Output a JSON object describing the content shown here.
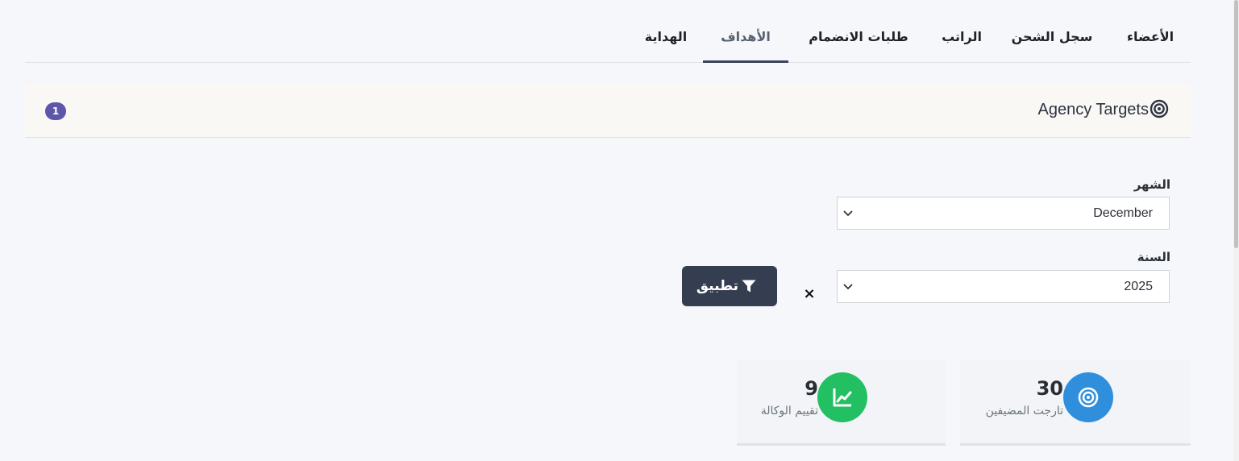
{
  "tabs": [
    {
      "label": "الأعضاء",
      "active": false
    },
    {
      "label": "سجل الشحن",
      "active": false
    },
    {
      "label": "الراتب",
      "active": false
    },
    {
      "label": "طلبات الانضمام",
      "active": false
    },
    {
      "label": "الأهداف",
      "active": true
    },
    {
      "label": "الهداية",
      "active": false
    }
  ],
  "panel": {
    "title": "Agency Targets",
    "icon": "target-icon",
    "badge": "1"
  },
  "form": {
    "month_label": "الشهر",
    "month_value": "December",
    "year_label": "السنة",
    "year_value": "2025",
    "clear_label": "×",
    "apply_label": "تطبيق"
  },
  "stats": [
    {
      "value": "30",
      "label": "تارجت المضيفين",
      "icon": "target-icon",
      "color": "#2f8fdc"
    },
    {
      "value": "9",
      "label": "تقييم الوكالة",
      "icon": "chart-line-icon",
      "color": "#22bf63"
    }
  ],
  "colors": {
    "primary_button": "#353e51",
    "badge": "#5e56a8",
    "active_tab_border": "#3b4457"
  }
}
